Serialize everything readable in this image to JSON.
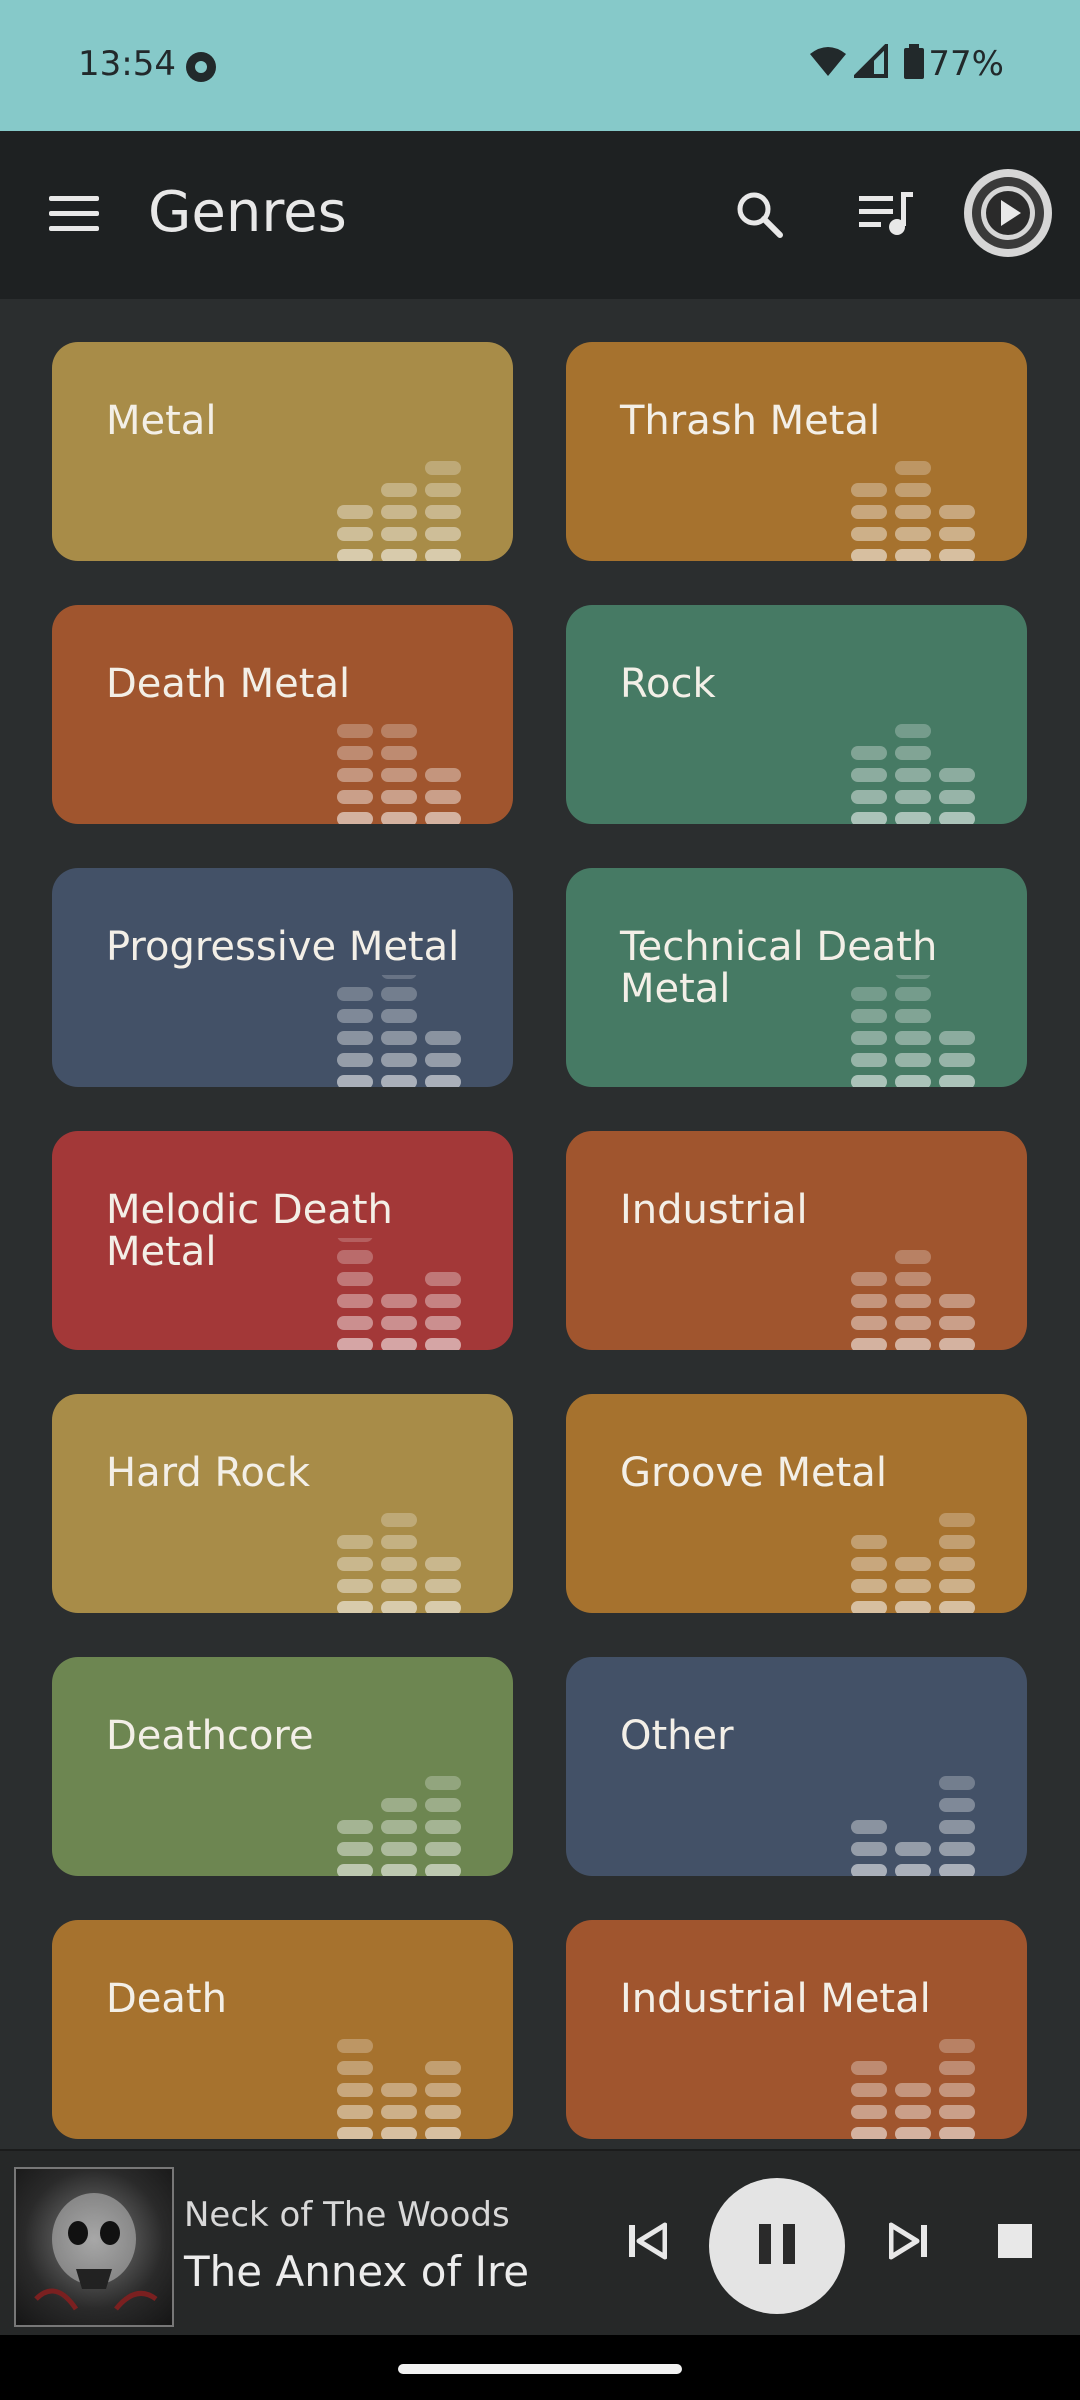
{
  "status_bar": {
    "time": "13:54",
    "battery": "77%"
  },
  "app_bar": {
    "title": "Genres"
  },
  "genres": [
    {
      "label": "Metal",
      "color": "#a88c48"
    },
    {
      "label": "Thrash Metal",
      "color": "#a6722e"
    },
    {
      "label": "Death Metal",
      "color": "#a0552e"
    },
    {
      "label": "Rock",
      "color": "#467a64"
    },
    {
      "label": "Progressive Metal",
      "color": "#435167"
    },
    {
      "label": "Technical Death Metal",
      "color": "#467a64"
    },
    {
      "label": "Melodic Death Metal",
      "color": "#a33838"
    },
    {
      "label": "Industrial",
      "color": "#a0552e"
    },
    {
      "label": "Hard Rock",
      "color": "#a88c48"
    },
    {
      "label": "Groove Metal",
      "color": "#a6722e"
    },
    {
      "label": "Deathcore",
      "color": "#6d8651"
    },
    {
      "label": "Other",
      "color": "#435167"
    },
    {
      "label": "Death",
      "color": "#a6722e"
    },
    {
      "label": "Industrial Metal",
      "color": "#a0552e"
    }
  ],
  "now_playing": {
    "artist": "Neck of The Woods",
    "title": "The Annex of Ire"
  },
  "icons": {
    "menu": "menu-icon",
    "search": "search-icon",
    "queue": "queue-music-icon",
    "player": "play-circle-icon",
    "previous": "skip-previous-icon",
    "pause": "pause-icon",
    "next": "skip-next-icon",
    "stop": "stop-icon"
  }
}
